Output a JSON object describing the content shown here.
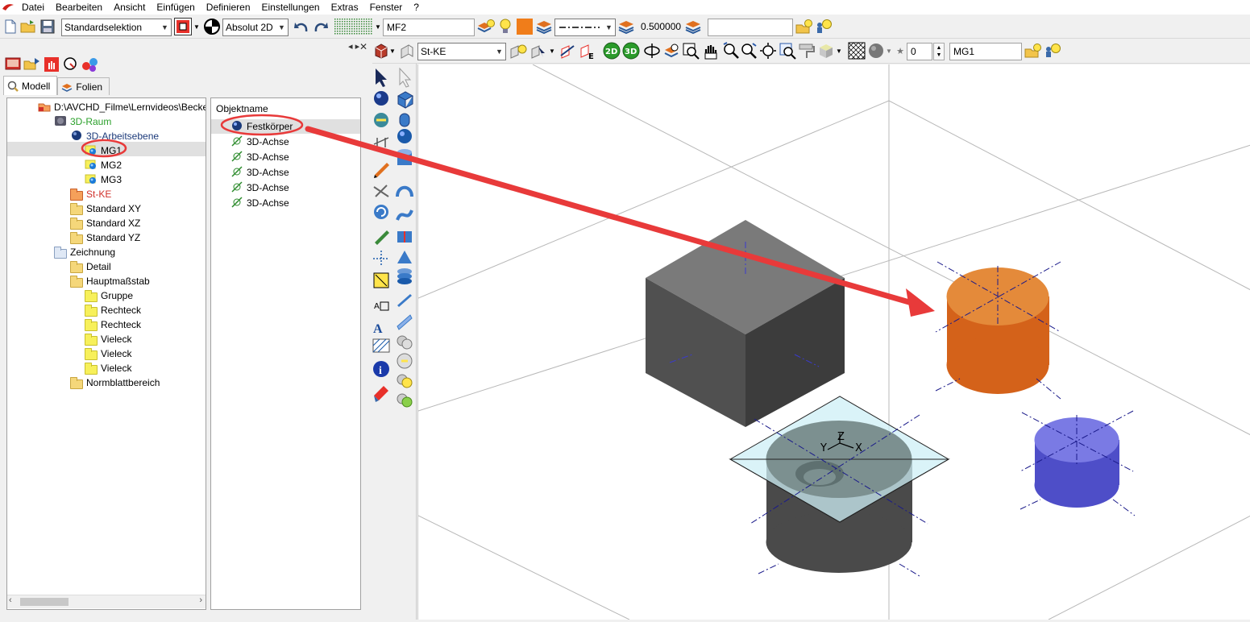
{
  "menu": {
    "items": [
      "Datei",
      "Bearbeiten",
      "Ansicht",
      "Einfügen",
      "Definieren",
      "Einstellungen",
      "Extras",
      "Fenster",
      "?"
    ]
  },
  "toolbar1": {
    "selection_mode": "Standardselektion",
    "coord_mode": "Absolut 2D",
    "layer_name": "MF2",
    "line_width": "0.500000",
    "accent_color": "#f07d1a"
  },
  "toolbar2": {
    "workplane": "St-KE",
    "counter_value": "0",
    "group_name": "MG1"
  },
  "tabs": {
    "model": "Modell",
    "layers": "Folien"
  },
  "tree": {
    "items": [
      {
        "label": "D:\\AVCHD_Filme\\Lernvideos\\Becke",
        "indent": 0,
        "color": "#000000",
        "icon": "file-red-icon"
      },
      {
        "label": "3D-Raum",
        "indent": 1,
        "color": "#2aa02a",
        "icon": "cube-icon"
      },
      {
        "label": "3D-Arbeitsebene",
        "indent": 2,
        "color": "#1c3a7a",
        "icon": "sphere-icon"
      },
      {
        "label": "MG1",
        "indent": 3,
        "color": "#000000",
        "icon": "group-icon",
        "selected": true
      },
      {
        "label": "MG2",
        "indent": 3,
        "color": "#000000",
        "icon": "group-icon"
      },
      {
        "label": "MG3",
        "indent": 3,
        "color": "#000000",
        "icon": "group-icon"
      },
      {
        "label": "St-KE",
        "indent": 2,
        "color": "#d0302a",
        "icon": "folder-icon"
      },
      {
        "label": "Standard XY",
        "indent": 2,
        "color": "#000000",
        "icon": "folder-icon"
      },
      {
        "label": "Standard XZ",
        "indent": 2,
        "color": "#000000",
        "icon": "folder-icon"
      },
      {
        "label": "Standard YZ",
        "indent": 2,
        "color": "#000000",
        "icon": "folder-icon"
      },
      {
        "label": "Zeichnung",
        "indent": 1,
        "color": "#000000",
        "icon": "drawing-folder-icon"
      },
      {
        "label": "Detail",
        "indent": 2,
        "color": "#000000",
        "icon": "folder-icon"
      },
      {
        "label": "Hauptmaßstab",
        "indent": 2,
        "color": "#000000",
        "icon": "folder-icon"
      },
      {
        "label": "Gruppe",
        "indent": 3,
        "color": "#000000",
        "icon": "yellow-folder-icon"
      },
      {
        "label": "Rechteck",
        "indent": 3,
        "color": "#000000",
        "icon": "yellow-folder-icon"
      },
      {
        "label": "Rechteck",
        "indent": 3,
        "color": "#000000",
        "icon": "yellow-folder-icon"
      },
      {
        "label": "Vieleck",
        "indent": 3,
        "color": "#000000",
        "icon": "yellow-folder-icon"
      },
      {
        "label": "Vieleck",
        "indent": 3,
        "color": "#000000",
        "icon": "yellow-folder-icon"
      },
      {
        "label": "Vieleck",
        "indent": 3,
        "color": "#000000",
        "icon": "yellow-folder-icon"
      },
      {
        "label": "Normblattbereich",
        "indent": 2,
        "color": "#000000",
        "icon": "folder-icon"
      }
    ]
  },
  "objects": {
    "header": "Objektname",
    "items": [
      {
        "label": "Festkörper",
        "icon": "solid-icon",
        "selected": true
      },
      {
        "label": "3D-Achse",
        "icon": "axis-icon"
      },
      {
        "label": "3D-Achse",
        "icon": "axis-icon"
      },
      {
        "label": "3D-Achse",
        "icon": "axis-icon"
      },
      {
        "label": "3D-Achse",
        "icon": "axis-icon"
      },
      {
        "label": "3D-Achse",
        "icon": "axis-icon"
      }
    ]
  },
  "viewport": {
    "axis_labels": {
      "y": "Y",
      "z": "Z",
      "x": "X"
    },
    "annotation_color": "#e83a3a",
    "cylinder_orange": "#e0701f",
    "cylinder_blue": "#6a6ad8",
    "cube_gray": "#6f6f6f"
  }
}
